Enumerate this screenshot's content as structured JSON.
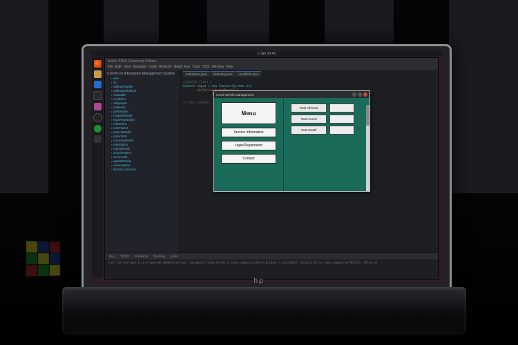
{
  "os": {
    "topbar_center": "6 Jan 20:40",
    "dock": [
      {
        "name": "firefox"
      },
      {
        "name": "files"
      },
      {
        "name": "vscode"
      },
      {
        "name": "terminal"
      },
      {
        "name": "app"
      },
      {
        "name": "obs"
      },
      {
        "name": "green"
      },
      {
        "name": "grid"
      }
    ]
  },
  "ide": {
    "title": "IntelliJ IDEA Community Edition",
    "menu": [
      "File",
      "Edit",
      "View",
      "Navigate",
      "Code",
      "Refactor",
      "Build",
      "Run",
      "Tools",
      "VCS",
      "Window",
      "Help"
    ],
    "project_header": "COVID-19 Information Management System",
    "tree_items": [
      "idea",
      "src",
      "addingHospital",
      "addingnewpatient",
      "casetable",
      "covidinfor",
      "dailyreport",
      "dataentry",
      "govtUpdate",
      "hospitalDetails",
      "loginRegistration",
      "mainMenu",
      "newPatient",
      "patientDetails",
      "patientInfo",
      "recoveryDetails",
      "registration",
      "reportDetails",
      "searchPatient",
      "serviceInfo",
      "updateDetails",
      "viewHospital",
      "External Libraries"
    ],
    "editor_tabs": [
      "mainMenu.java",
      "dataentry.java",
      "covidinfor.java"
    ],
    "code_lines": [
      "//public class {",
      "Scanner input = new Scanner(System.in);",
      "    while(input.hasNext()){",
      "        if(countPatient() == ){",
      "",
      "// text setOne(..., input.next()...)"
    ],
    "bottom_tabs": [
      "Run",
      "TODO",
      "Problems",
      "Terminal",
      "Build"
    ],
    "console_line": "/usr/lib/jvm/java-1.11.0-openjdk-amd64/bin/java -javaagent:/snap/intellij-idea-community/391/lib/idea_rt.jar=45027:/snap/intellij-idea-community/391/bin -Dfile.en"
  },
  "swing": {
    "title": "Covid-19 Info Management",
    "menu_label": "Menu",
    "buttons": {
      "service": "Service Information",
      "login": "Login/Registration",
      "contact": "Contact"
    },
    "stats": {
      "affected_label": "Total Affected",
      "affected_value": "",
      "cured_label": "Total Cured",
      "cured_value": "",
      "death_label": "Total Death",
      "death_value": ""
    }
  },
  "hardware_logo": "hp"
}
